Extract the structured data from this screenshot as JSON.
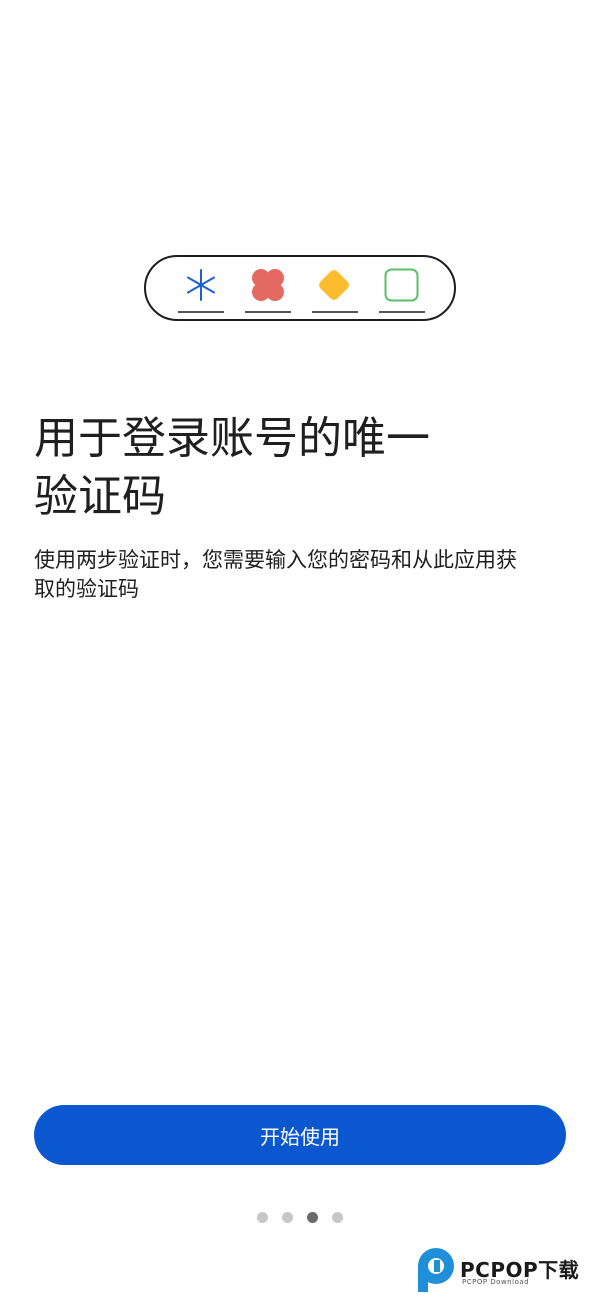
{
  "onboarding": {
    "headline_line1": "用于登录账号的唯一",
    "headline_line2": "验证码",
    "description_line1": "使用两步验证时，您需要输入您的密码和从此应用获",
    "description_line2": "取的验证码",
    "start_button_label": "开始使用",
    "page_count": 4,
    "current_page_index": 2
  },
  "illustration": {
    "icons": [
      "asterisk-icon",
      "flower-shape-icon",
      "diamond-shape-icon",
      "rounded-square-icon"
    ],
    "colors": {
      "asterisk": "#1a5fd6",
      "flower": "#e46962",
      "diamond": "#fbbc2e",
      "square": "#5bbf6a"
    }
  },
  "watermark": {
    "brand": "PCPOP下载",
    "sub": "PCPOP Download"
  },
  "theme": {
    "accent": "#0b57d0",
    "text": "#1f1f1f",
    "dot_inactive": "#c7c7c7",
    "dot_active": "#6b6b6b"
  }
}
